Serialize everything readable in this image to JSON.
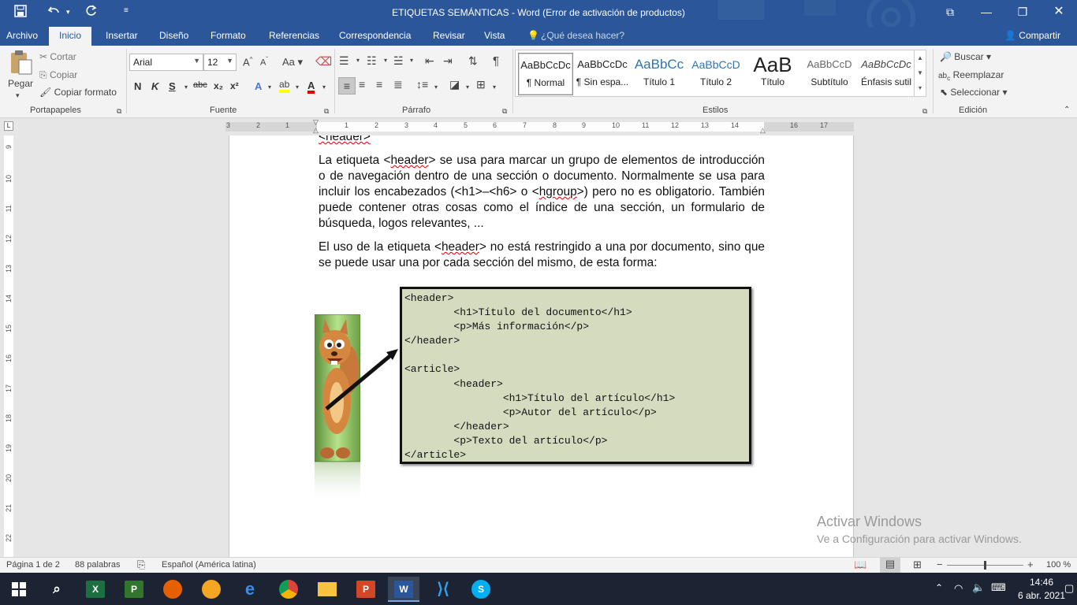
{
  "window": {
    "title": "ETIQUETAS SEMÁNTICAS - Word (Error de activación de productos)"
  },
  "quick_access": {
    "save_icon": "save-icon",
    "undo_icon": "undo-icon",
    "redo_icon": "redo-icon",
    "customize_icon": "customize-icon"
  },
  "tabs": [
    {
      "label": "Archivo"
    },
    {
      "label": "Inicio"
    },
    {
      "label": "Insertar"
    },
    {
      "label": "Diseño"
    },
    {
      "label": "Formato"
    },
    {
      "label": "Referencias"
    },
    {
      "label": "Correspondencia"
    },
    {
      "label": "Revisar"
    },
    {
      "label": "Vista"
    }
  ],
  "tell_me": "¿Qué desea hacer?",
  "share": "Compartir",
  "ribbon": {
    "clipboard": {
      "paste": "Pegar",
      "cut": "Cortar",
      "copy": "Copiar",
      "format_painter": "Copiar formato",
      "label": "Portapapeles"
    },
    "font": {
      "family": "Arial",
      "size": "12",
      "label": "Fuente",
      "bold": "N",
      "italic": "K",
      "underline": "S",
      "strike": "abc",
      "sub": "x₂",
      "sup": "x²",
      "grow": "A^",
      "shrink": "Aˇ",
      "case": "Aa",
      "color_a": "A",
      "text_effects": "A"
    },
    "paragraph": {
      "label": "Párrafo",
      "pilcrow": "¶"
    },
    "styles": {
      "label": "Estilos",
      "items": [
        {
          "preview": "AaBbCcDc",
          "name": "¶ Normal"
        },
        {
          "preview": "AaBbCcDc",
          "name": "¶ Sin espa..."
        },
        {
          "preview": "AaBbCc",
          "name": "Título 1"
        },
        {
          "preview": "AaBbCcD",
          "name": "Título 2"
        },
        {
          "preview": "AaB",
          "name": "Título"
        },
        {
          "preview": "AaBbCcD",
          "name": "Subtítulo"
        },
        {
          "preview": "AaBbCcDc",
          "name": "Énfasis sutil"
        }
      ]
    },
    "editing": {
      "label": "Edición",
      "find": "Buscar",
      "replace": "Reemplazar",
      "select": "Seleccionar"
    }
  },
  "ruler": {
    "h_numbers": [
      "3",
      "2",
      "1",
      "1",
      "2",
      "3",
      "4",
      "5",
      "6",
      "7",
      "8",
      "9",
      "10",
      "11",
      "12",
      "13",
      "14",
      "16",
      "17"
    ],
    "v_numbers": [
      "9",
      "10",
      "11",
      "12",
      "13",
      "14",
      "15",
      "16",
      "17",
      "18",
      "19",
      "20",
      "21",
      "22"
    ]
  },
  "document": {
    "heading_fragment": "<header>",
    "p1_a": "La etiqueta <",
    "p1_tag": "header",
    "p1_b": "> se usa para marcar un grupo de elementos de introducción o de navegación dentro de una sección o documento. Normalmente se usa para incluir los encabezados (<h1>–<h6> o <",
    "p1_tag2": "hgroup",
    "p1_c": ">) pero no es obligatorio. También puede contener otras cosas como el índice de una sección, un formulario de búsqueda, logos relevantes, ...",
    "p2_a": "El uso de la etiqueta <",
    "p2_tag": "header",
    "p2_b": "> no está restringido a una por documento, sino que se puede usar una por cada sección del mismo, de esta forma:",
    "code_lines": [
      "<header>",
      "        <h1>Título del documento</h1>",
      "        <p>Más información</p>",
      "</header>",
      "",
      "<article>",
      "        <header>",
      "                <h1>Título del artículo</h1>",
      "                <p>Autor del artículo</p>",
      "        </header>",
      "        <p>Texto del artículo</p>",
      "</article>"
    ]
  },
  "watermark": {
    "line1": "Activar Windows",
    "line2": "Ve a Configuración para activar Windows."
  },
  "status": {
    "page": "Página 1 de 2",
    "words": "88 palabras",
    "language": "Español (América latina)",
    "zoom": "100 %"
  },
  "taskbar": {
    "time": "14:46",
    "date": "6 abr. 2021"
  }
}
